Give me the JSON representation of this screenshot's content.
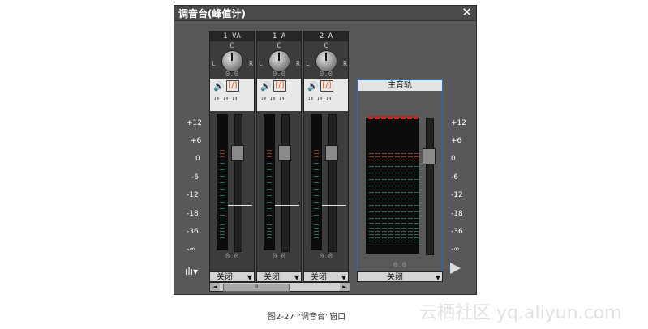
{
  "window": {
    "title": "调音台(峰值计)",
    "close_glyph": "✕"
  },
  "strips": [
    {
      "name": "1 VA",
      "pan_center": "C",
      "pan_left": "L",
      "pan_right": "R",
      "pan_value": "0.0",
      "mute_icon": "speaker-icon",
      "solo_glyph": "[/]",
      "record_glyphs": "↓↑ ↓↑ ↓↑",
      "level_value": "0.0",
      "output_select": "关闭"
    },
    {
      "name": "1 A",
      "pan_center": "C",
      "pan_left": "L",
      "pan_right": "R",
      "pan_value": "0.0",
      "mute_icon": "speaker-icon",
      "solo_glyph": "[/]",
      "record_glyphs": "↓↑ ↓↑ ↓↑",
      "level_value": "0.0",
      "output_select": "关闭"
    },
    {
      "name": "2 A",
      "pan_center": "C",
      "pan_left": "L",
      "pan_right": "R",
      "pan_value": "0.0",
      "mute_icon": "speaker-icon",
      "solo_glyph": "[/]",
      "record_glyphs": "↓↑ ↓↑ ↓↑",
      "level_value": "0.0",
      "output_select": "关闭"
    }
  ],
  "scale_left": [
    "+12",
    "+6",
    "0",
    "-6",
    "-12",
    "-18",
    "-36",
    "-∞"
  ],
  "scale_right": [
    "+12",
    "+6",
    "0",
    "-6",
    "-12",
    "-18",
    "-36",
    "-∞"
  ],
  "master": {
    "title": "主音轨",
    "level_value": "0.0",
    "output_select": "关闭"
  },
  "scrollbar": {
    "left_arrow": "◄",
    "right_arrow": "►",
    "thumb_grip": "III"
  },
  "footer": {
    "meter_icon": "bar-chart-icon",
    "meter_glyph": "ılı▾",
    "play_icon": "play-triangle-icon"
  },
  "caption": "图2-27  “调音台”窗口",
  "watermark": "云栖社区 yq.aliyun.com",
  "colors": {
    "window_bg": "#555555",
    "strip_bg": "#3c3c3c",
    "master_border": "#1f6fcc",
    "peak_red": "#c42020"
  }
}
